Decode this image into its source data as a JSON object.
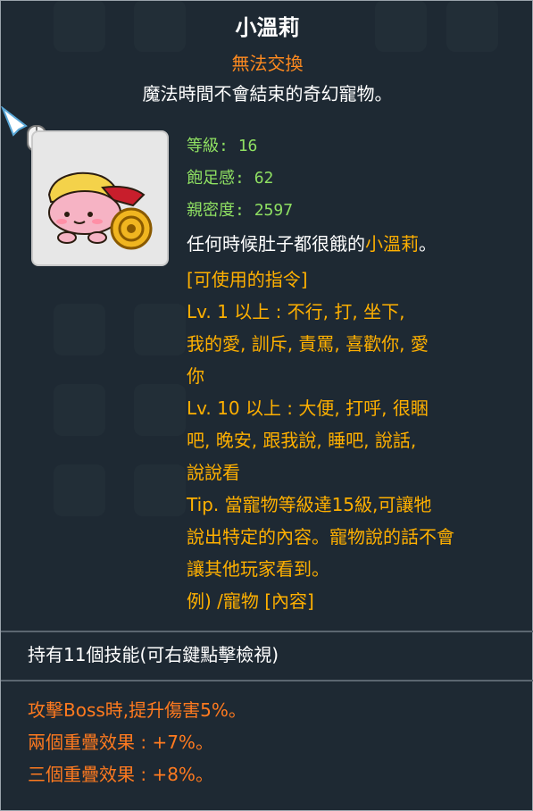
{
  "pet": {
    "name": "小溫莉",
    "trade_status": "無法交換",
    "description": "魔法時間不會結束的奇幻寵物。",
    "stats": {
      "level_label": "等級:",
      "level_value": "16",
      "satiety_label": "飽足感:",
      "satiety_value": "62",
      "intimacy_label": "親密度:",
      "intimacy_value": "2597"
    },
    "hunger_text_prefix": "任何時候肚子都很餓的",
    "hunger_text_name": "小溫莉",
    "hunger_text_suffix": "。",
    "commands_header": "[可使用的指令]",
    "commands_lv1": "Lv. 1 以上 : 不行, 打, 坐下,",
    "commands_lv1_line2": "我的愛, 訓斥, 責罵, 喜歡你, 愛",
    "commands_lv1_line3": "你",
    "commands_lv10": "Lv. 10 以上 : 大便, 打呼, 很睏",
    "commands_lv10_line2": "吧, 晚安, 跟我說, 睡吧, 說話,",
    "commands_lv10_line3": "說說看",
    "tip_line1": "Tip. 當寵物等級達15級,可讓牠",
    "tip_line2": "說出特定的內容。寵物說的話不會",
    "tip_line3": "讓其他玩家看到。",
    "tip_line4": "例) /寵物 [內容]"
  },
  "skills": {
    "header": "持有11個技能(可右鍵點擊檢視)",
    "effect1": "攻擊Boss時,提升傷害5%。",
    "effect2": "兩個重疊效果 : +7%。",
    "effect3": "三個重疊效果 : +8%。"
  },
  "icons": {
    "pet_icon": "pet-portrait-icon",
    "cursor_icon": "mouse-cursor-icon"
  },
  "colors": {
    "title": "#ffffff",
    "trade_status": "#ff8a1f",
    "stats": "#8fe062",
    "command_text": "#ffb000",
    "effect": "#ff7a1f"
  }
}
